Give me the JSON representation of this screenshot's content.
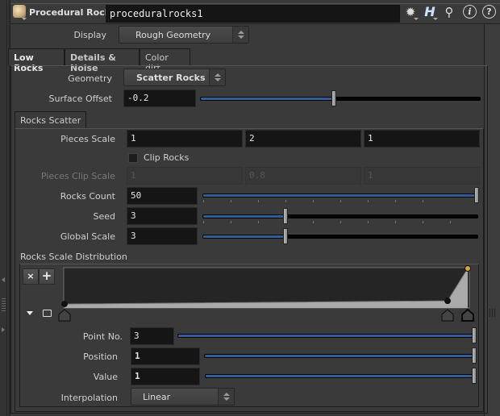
{
  "header": {
    "node_type": "Procedural Rocks",
    "node_name": "proceduralrocks1",
    "icons": [
      "node-icon",
      "gear-icon",
      "houdini-h-icon",
      "search-icon",
      "info-icon",
      "help-icon"
    ]
  },
  "display": {
    "label": "Display",
    "value": "Rough Geometry"
  },
  "tabs": [
    {
      "label": "Low Rocks",
      "active": true
    },
    {
      "label": "Details & Noise",
      "active": false
    },
    {
      "label": "Color dirt",
      "active": false
    }
  ],
  "geometry": {
    "label": "Geometry",
    "value": "Scatter Rocks"
  },
  "surface_offset": {
    "label": "Surface Offset",
    "value": "-0.2",
    "slider_fraction": 0.4
  },
  "subtab": {
    "label": "Rocks Scatter"
  },
  "pieces_scale": {
    "label": "Pieces Scale",
    "values": [
      "1",
      "2",
      "1"
    ]
  },
  "clip_rocks": {
    "label": "Clip Rocks",
    "checked": false
  },
  "pieces_clip_scale": {
    "label": "Pieces Clip Scale",
    "values": [
      "1",
      "0.8",
      "1"
    ],
    "disabled": true
  },
  "rocks_count": {
    "label": "Rocks Count",
    "value": "50",
    "slider_fraction": 1.0
  },
  "seed": {
    "label": "Seed",
    "value": "3",
    "slider_fraction": 0.3
  },
  "global_scale": {
    "label": "Global Scale",
    "value": "3",
    "slider_fraction": 0.3
  },
  "ramp": {
    "label": "Rocks Scale Distribution",
    "delete_label": "×",
    "add_label": "+",
    "points": [
      {
        "position": 0.0,
        "value": 0.1
      },
      {
        "position": 0.95,
        "value": 0.18
      },
      {
        "position": 1.0,
        "value": 1.0
      }
    ],
    "selected_point": 3
  },
  "point_no": {
    "label": "Point No.",
    "value": "3",
    "slider_fraction": 1.0
  },
  "position": {
    "label": "Position",
    "value": "1",
    "slider_fraction": 1.0
  },
  "value": {
    "label": "Value",
    "value": "1",
    "slider_fraction": 1.0
  },
  "interpolation": {
    "label": "Interpolation",
    "value": "Linear"
  }
}
